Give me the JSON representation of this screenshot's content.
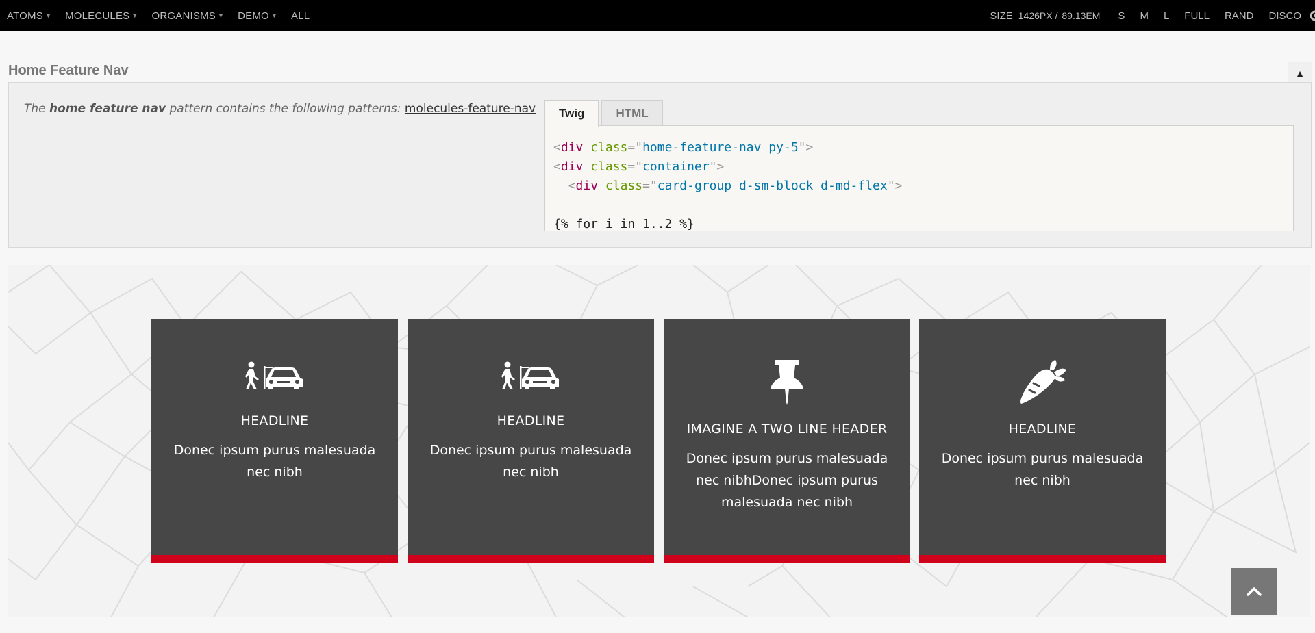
{
  "toolbar": {
    "nav": [
      {
        "label": "ATOMS",
        "caret": true
      },
      {
        "label": "MOLECULES",
        "caret": true
      },
      {
        "label": "ORGANISMS",
        "caret": true
      },
      {
        "label": "DEMO",
        "caret": true
      },
      {
        "label": "ALL",
        "caret": false
      }
    ],
    "size_label": "SIZE",
    "size_px": "1426PX /",
    "size_em": "89.13EM",
    "viewport_buttons": [
      "S",
      "M",
      "L",
      "FULL",
      "RAND",
      "DISCO"
    ],
    "icons": {
      "caret": "caret-down-icon",
      "settings": "gear-icon"
    }
  },
  "pattern": {
    "title": "Home Feature Nav",
    "collapse_symbol": "▲",
    "desc_prefix": "The ",
    "desc_strong": "home feature nav",
    "desc_middle": " pattern contains the following patterns: ",
    "desc_link": "molecules-feature-nav",
    "tabs": [
      {
        "label": "Twig",
        "active": true
      },
      {
        "label": "HTML",
        "active": false
      }
    ],
    "code": {
      "line1_tag": "div",
      "line1_attr": "class",
      "line1_val": "home-feature-nav py-5",
      "line2_tag": "div",
      "line2_attr": "class",
      "line2_val": "container",
      "line3_tag": "div",
      "line3_attr": "class",
      "line3_val": "card-group d-sm-block d-md-flex",
      "line5": "{% for i in 1..2 %}"
    }
  },
  "cards": [
    {
      "icon": "pedestrian-car-icon",
      "headline": "HEADLINE",
      "text": "Donec ipsum purus malesuada nec nibh"
    },
    {
      "icon": "pedestrian-car-icon",
      "headline": "HEADLINE",
      "text": "Donec ipsum purus malesuada nec nibh"
    },
    {
      "icon": "push-pin-icon",
      "headline": "IMAGINE A TWO LINE HEADER",
      "text": "Donec ipsum purus malesuada nec nibhDonec ipsum purus malesuada nec nibh"
    },
    {
      "icon": "carrot-icon",
      "headline": "HEADLINE",
      "text": "Donec ipsum purus malesuada nec nibh"
    }
  ],
  "colors": {
    "toolbar_bg": "#000000",
    "card_bg": "#474747",
    "card_accent": "#d0021b",
    "scroll_button": "#777777"
  },
  "scroll_top": {
    "icon": "chevron-up-icon"
  }
}
